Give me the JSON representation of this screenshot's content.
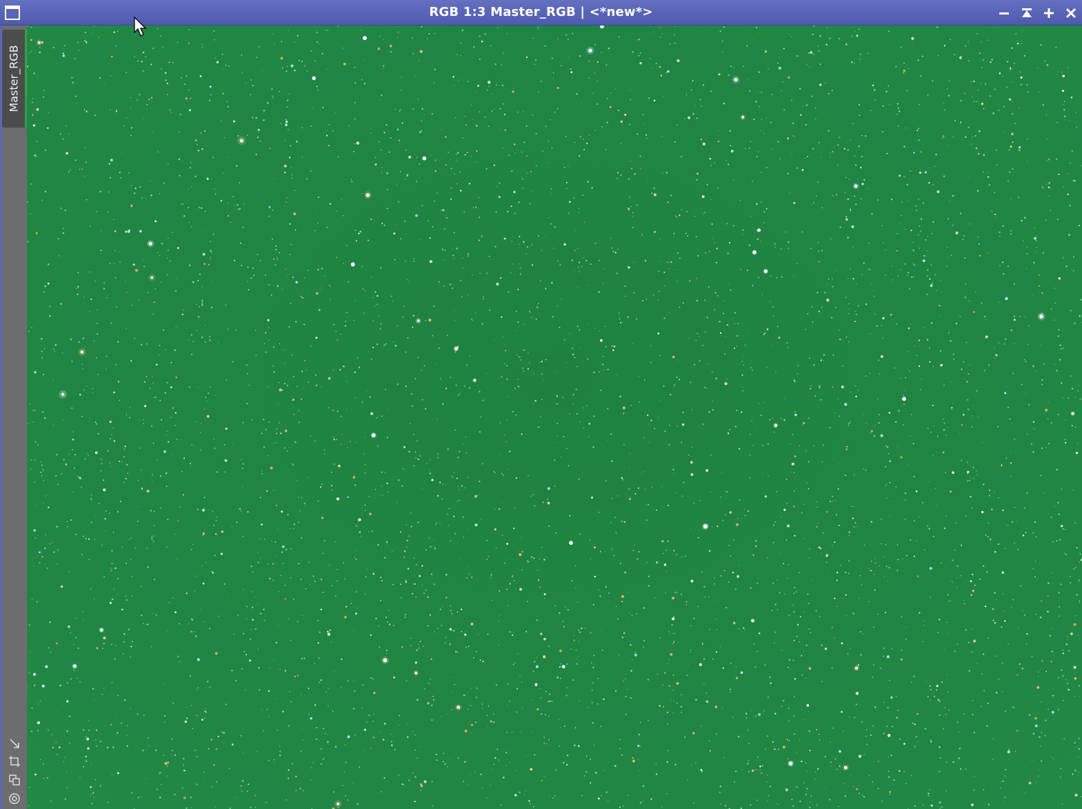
{
  "window": {
    "title": "RGB 1:3 Master_RGB | <*new*>",
    "image_background_color": "#1f8442",
    "titlebar_color": "#5a66b8",
    "buttons": [
      {
        "name": "minimize-button",
        "icon": "minus-icon"
      },
      {
        "name": "shade-button",
        "icon": "shade-up-icon"
      },
      {
        "name": "maximize-button",
        "icon": "plus-icon"
      },
      {
        "name": "close-button",
        "icon": "close-icon"
      }
    ]
  },
  "sidebar": {
    "view_tab_label": "Master_RGB",
    "tab_accent_color": "#2ea14c",
    "tools": [
      {
        "name": "zoom-to-fit-icon"
      },
      {
        "name": "fit-view-icon"
      },
      {
        "name": "clone-view-icon"
      },
      {
        "name": "view-identifier-icon"
      }
    ]
  },
  "image": {
    "content": "star-field",
    "star_colors": [
      "#ffffff",
      "#e6fff0",
      "#ffd890",
      "#ffb060",
      "#b8f0ff"
    ]
  }
}
